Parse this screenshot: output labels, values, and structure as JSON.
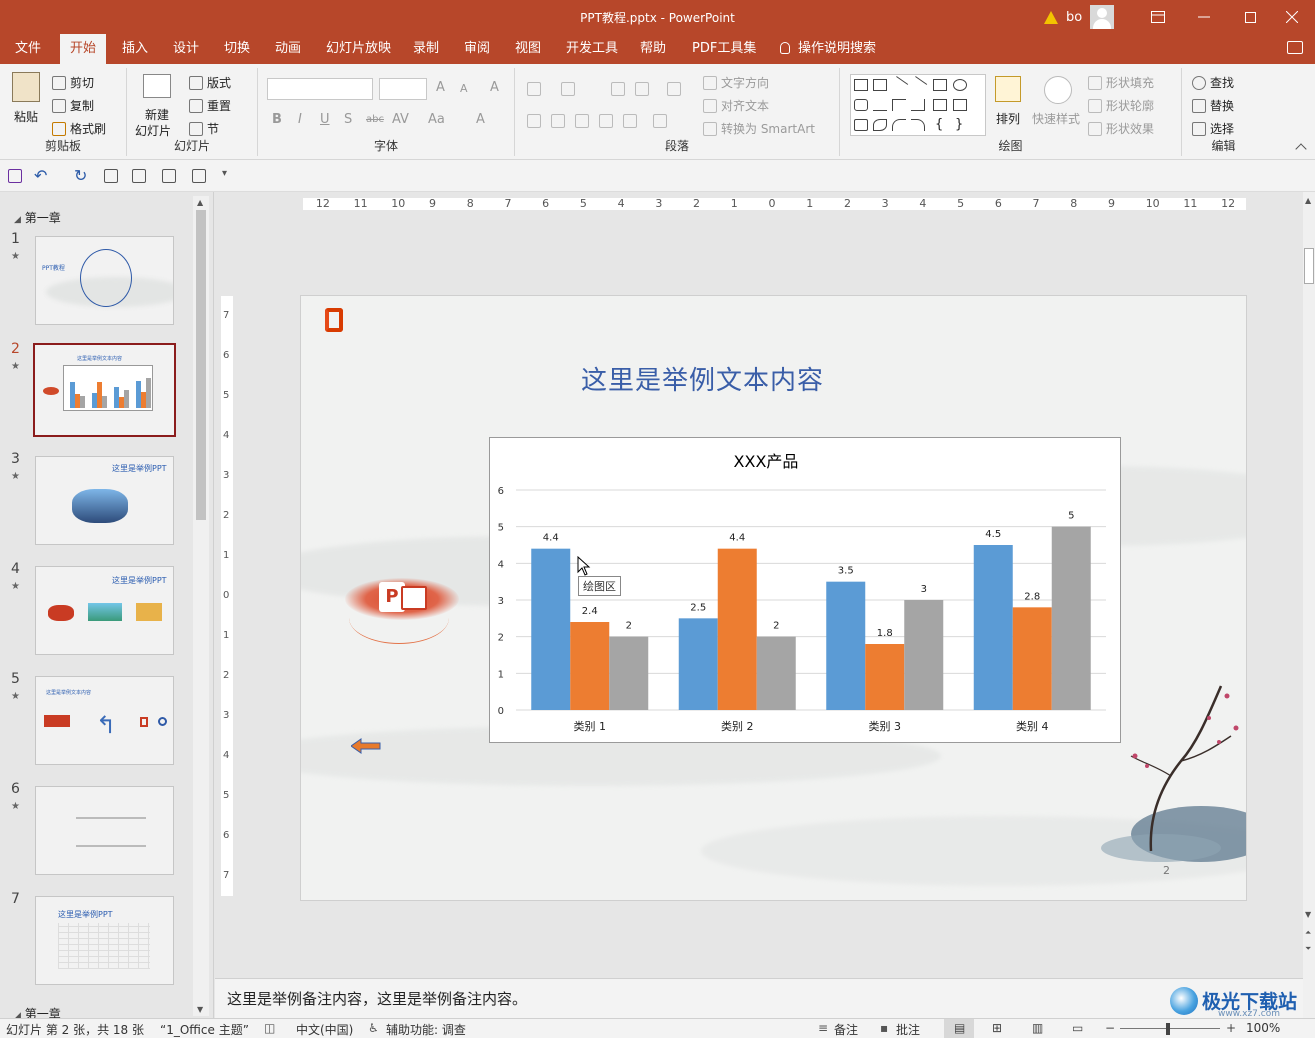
{
  "window": {
    "title": "PPT教程.pptx  -  PowerPoint",
    "user": "bo",
    "controls": [
      "restore-ribbon",
      "minimize",
      "maximize",
      "close"
    ]
  },
  "tabs": [
    {
      "label": "文件",
      "active": false
    },
    {
      "label": "开始",
      "active": true
    },
    {
      "label": "插入",
      "active": false
    },
    {
      "label": "设计",
      "active": false
    },
    {
      "label": "切换",
      "active": false
    },
    {
      "label": "动画",
      "active": false
    },
    {
      "label": "幻灯片放映",
      "active": false
    },
    {
      "label": "录制",
      "active": false
    },
    {
      "label": "审阅",
      "active": false
    },
    {
      "label": "视图",
      "active": false
    },
    {
      "label": "开发工具",
      "active": false
    },
    {
      "label": "帮助",
      "active": false
    },
    {
      "label": "PDF工具集",
      "active": false
    },
    {
      "label": "操作说明搜索",
      "active": false
    }
  ],
  "ribbon": {
    "clipboard": {
      "label": "剪贴板",
      "paste": "粘贴",
      "cut": "剪切",
      "copy": "复制",
      "painter": "格式刷"
    },
    "slides": {
      "label": "幻灯片",
      "new_slide_1": "新建",
      "new_slide_2": "幻灯片",
      "layout": "版式",
      "reset": "重置",
      "section": "节"
    },
    "font": {
      "label": "字体"
    },
    "paragraph": {
      "label": "段落",
      "text_direction": "文字方向",
      "align_text": "对齐文本",
      "smartart": "转换为 SmartArt"
    },
    "drawing": {
      "label": "绘图",
      "arrange": "排列",
      "quick_styles": "快速样式",
      "shape_fill": "形状填充",
      "shape_outline": "形状轮廓",
      "shape_effects": "形状效果"
    },
    "editing": {
      "label": "编辑",
      "find": "查找",
      "replace": "替换",
      "select": "选择"
    }
  },
  "ruler": {
    "ticks": [
      "12",
      "11",
      "10",
      "9",
      "8",
      "7",
      "6",
      "5",
      "4",
      "3",
      "2",
      "1",
      "0",
      "1",
      "2",
      "3",
      "4",
      "5",
      "6",
      "7",
      "8",
      "9",
      "10",
      "11",
      "12"
    ],
    "vticks": [
      "7",
      "6",
      "5",
      "4",
      "3",
      "2",
      "1",
      "0",
      "1",
      "2",
      "3",
      "4",
      "5",
      "6",
      "7"
    ]
  },
  "thumbnails": {
    "section1": "第一章",
    "section2": "第一章",
    "items": [
      {
        "num": "1",
        "star": "★",
        "selected": false,
        "text": "PPT教程"
      },
      {
        "num": "2",
        "star": "★",
        "selected": true,
        "text": "这里是举例文本内容"
      },
      {
        "num": "3",
        "star": "★",
        "selected": false,
        "text": "这里是举例PPT"
      },
      {
        "num": "4",
        "star": "★",
        "selected": false,
        "text": "这里是举例PPT"
      },
      {
        "num": "5",
        "star": "★",
        "selected": false,
        "text": "这里是举例文本内容"
      },
      {
        "num": "6",
        "star": "★",
        "selected": false,
        "text": ""
      },
      {
        "num": "7",
        "star": "",
        "selected": false,
        "text": "这里是举例PPT"
      }
    ]
  },
  "slide": {
    "title": "这里是举例文本内容",
    "page_number": "2",
    "tooltip": "绘图区"
  },
  "chart_data": {
    "type": "bar",
    "title": "XXX产品",
    "categories": [
      "类别 1",
      "类别 2",
      "类别 3",
      "类别 4"
    ],
    "series": [
      {
        "values": [
          4.4,
          2.5,
          3.5,
          4.5
        ],
        "color": "#5b9bd5"
      },
      {
        "values": [
          2.4,
          4.4,
          1.8,
          2.8
        ],
        "color": "#ed7d31"
      },
      {
        "values": [
          2,
          2,
          3,
          5
        ],
        "color": "#a5a5a5"
      }
    ],
    "ylim": [
      0,
      6
    ],
    "yticks": [
      "0",
      "1",
      "2",
      "3",
      "4",
      "5",
      "6"
    ],
    "grid": true,
    "data_labels": true
  },
  "notes": "这里是举例备注内容，这里是举例备注内容。",
  "status": {
    "slide_info": "幻灯片 第 2 张，共 18 张",
    "theme": "“1_Office 主题”",
    "language": "中文(中国)",
    "accessibility": "辅助功能: 调查",
    "notes_btn": "备注",
    "comments_btn": "批注",
    "zoom": "100%"
  },
  "watermark": {
    "text": "极光下载站",
    "sub": "www.xz7.com"
  }
}
